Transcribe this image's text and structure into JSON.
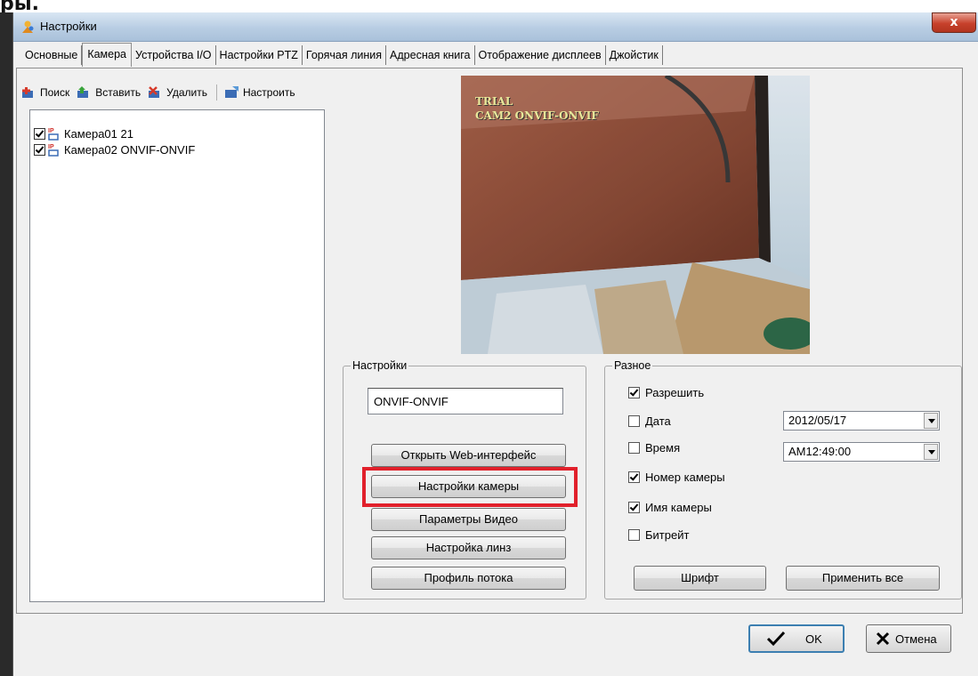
{
  "window": {
    "top_text": "ры.",
    "title": "Настройки",
    "close_label": "x"
  },
  "tabs": [
    "Основные",
    "Камера",
    "Устройства I/O",
    "Настройки PTZ",
    "Горячая линия",
    "Адресная книга",
    "Отображение дисплеев",
    "Джойстик"
  ],
  "active_tab": "Камера",
  "toolbar": {
    "search": "Поиск",
    "insert": "Вставить",
    "delete": "Удалить",
    "configure": "Настроить"
  },
  "camera_list": [
    {
      "label": "Камера01 21",
      "checked": true
    },
    {
      "label": "Камера02 ONVIF-ONVIF",
      "checked": true
    }
  ],
  "preview": {
    "overlay_line1": "TRIAL",
    "overlay_line2": "CAM2 ONVIF-ONVIF"
  },
  "settings_group": {
    "legend": "Настройки",
    "name_value": "ONVIF-ONVIF",
    "buttons": {
      "web": "Открыть Web-интерфейс",
      "camera_settings": "Настройки камеры",
      "video_params": "Параметры Видео",
      "lens": "Настройка линз",
      "stream_profile": "Профиль потока"
    }
  },
  "misc_group": {
    "legend": "Разное",
    "enable": {
      "label": "Разрешить",
      "checked": true
    },
    "date": {
      "label": "Дата",
      "checked": false,
      "value": "2012/05/17"
    },
    "time": {
      "label": "Время",
      "checked": false,
      "value": "AM12:49:00"
    },
    "camera_number": {
      "label": "Номер камеры",
      "checked": true
    },
    "camera_name": {
      "label": "Имя камеры",
      "checked": true
    },
    "bitrate": {
      "label": "Битрейт",
      "checked": false
    },
    "font_button": "Шрифт",
    "apply_all_button": "Применить все"
  },
  "dialog_buttons": {
    "ok": "OK",
    "cancel": "Отмена"
  },
  "colors": {
    "highlight": "#e1202b",
    "overlay_text": "#e8e79a"
  }
}
